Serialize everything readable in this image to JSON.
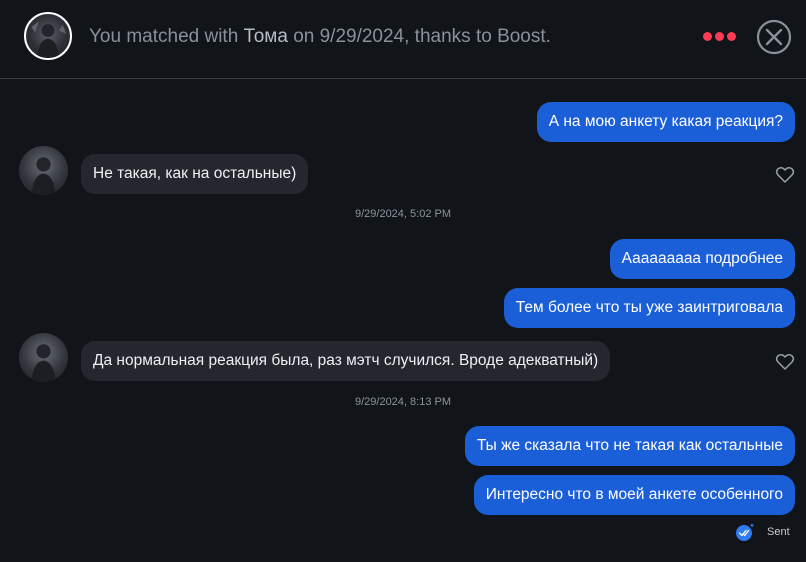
{
  "header": {
    "prefix": "You matched with",
    "match_name": "Тома",
    "suffix": "on 9/29/2024, thanks to Boost."
  },
  "colors": {
    "outgoing_bubble": "#1b5fd8",
    "incoming_bubble": "#24272d",
    "menu_dots": "#fd3b54",
    "background": "#111418"
  },
  "icons": {
    "menu": "more-dots-icon",
    "close": "close-circle-icon",
    "like": "heart-outline-icon",
    "read": "double-check-icon"
  },
  "messages": [
    {
      "direction": "out",
      "text": "А на мою анкету какая реакция?"
    },
    {
      "direction": "in",
      "text": "Не такая, как на остальные)"
    },
    {
      "timestamp": "9/29/2024, 5:02 PM"
    },
    {
      "direction": "out",
      "text": "Ааааааааа подробнее"
    },
    {
      "direction": "out",
      "text": "Тем более что ты уже заинтриговала"
    },
    {
      "direction": "in",
      "text": "Да нормальная реакция была, раз мэтч случился. Вроде адекватный)"
    },
    {
      "timestamp": "9/29/2024, 8:13 PM"
    },
    {
      "direction": "out",
      "text": "Ты же сказала что не такая как остальные"
    },
    {
      "direction": "out",
      "text": "Интересно что в моей анкете особенного"
    }
  ],
  "status": {
    "sent_label": "Sent"
  }
}
